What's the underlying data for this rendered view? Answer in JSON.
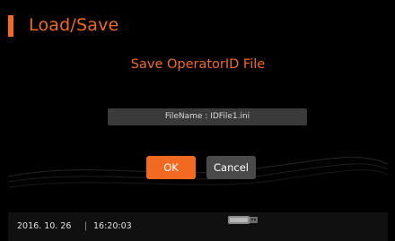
{
  "header": {
    "title": "Load/Save"
  },
  "dialog": {
    "title": "Save OperatorID File",
    "filename_text": "FileName : IDFile1.ini",
    "ok_label": "OK",
    "cancel_label": "Cancel"
  },
  "status_bar": {
    "date": "2016. 10. 26",
    "separator": "|",
    "time": "16:20:03",
    "device_icon": "usb-storage-icon"
  },
  "colors": {
    "accent": "#f26a21",
    "background": "#000000",
    "field": "#3a3a3a",
    "cancel_button": "#4a4a4a"
  }
}
